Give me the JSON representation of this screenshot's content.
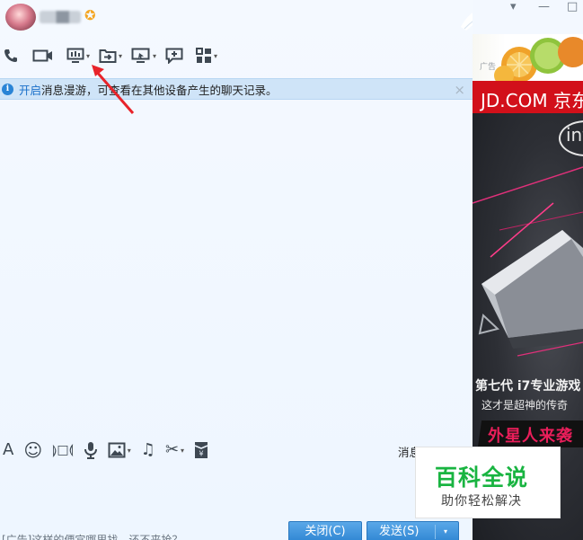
{
  "window": {
    "controls": [
      "▾",
      "—",
      "□"
    ]
  },
  "header": {
    "vip_icon": "star-icon",
    "vip_glyph": "✪"
  },
  "toolbar": {
    "items": [
      {
        "name": "phone-icon",
        "has_menu": false
      },
      {
        "name": "video-camera-icon",
        "has_menu": false
      },
      {
        "name": "screen-share-icon",
        "has_menu": true
      },
      {
        "name": "file-transfer-icon",
        "has_menu": true
      },
      {
        "name": "remote-desktop-icon",
        "has_menu": true
      },
      {
        "name": "add-message-icon",
        "has_menu": false
      },
      {
        "name": "apps-grid-icon",
        "has_menu": true
      }
    ],
    "caret": "▾"
  },
  "infobar": {
    "icon_text": "i",
    "link": "开启",
    "text": "消息漫游，可查看在其他设备产生的聊天记录。",
    "close": "×"
  },
  "input_toolbar": {
    "items": [
      {
        "name": "font-icon",
        "glyph": "A",
        "has_menu": false
      },
      {
        "name": "emoji-icon",
        "glyph": "☺",
        "has_menu": false
      },
      {
        "name": "shake-icon",
        "glyph": "⟭□⟬",
        "has_menu": false
      },
      {
        "name": "microphone-icon",
        "glyph": "🎙",
        "has_menu": false
      },
      {
        "name": "image-icon",
        "glyph": "▣",
        "has_menu": true
      },
      {
        "name": "music-icon",
        "glyph": "♫",
        "has_menu": false
      },
      {
        "name": "scissors-icon",
        "glyph": "✂",
        "has_menu": true
      },
      {
        "name": "red-packet-icon",
        "glyph": "¥",
        "has_menu": false
      }
    ],
    "history_label": "消息记录"
  },
  "bottom": {
    "ad_text": "[广告]这样的便宜哪里找，还不来抢？",
    "close_label": "关闭(C)",
    "send_label": "发送(S)",
    "send_caret": "▾"
  },
  "ad_panel": {
    "ad_label": "广告",
    "jd_text": "JD.COM 京东",
    "intel_text": "intel",
    "cpu_line": "第七代 i7专业游戏",
    "tagline": "这才是超神的传奇",
    "slogan": "外星人来袭"
  },
  "watermark": {
    "title": "百科全说",
    "subtitle": "助你轻松解决"
  },
  "colors": {
    "accent_blue": "#2f86d3",
    "info_bar": "#cfe4f8",
    "link_blue": "#1a6fc9",
    "annotation_red": "#e8232a",
    "jd_red": "#d2101a",
    "baike_green": "#19b441",
    "slogan_pink": "#e91e5a"
  }
}
